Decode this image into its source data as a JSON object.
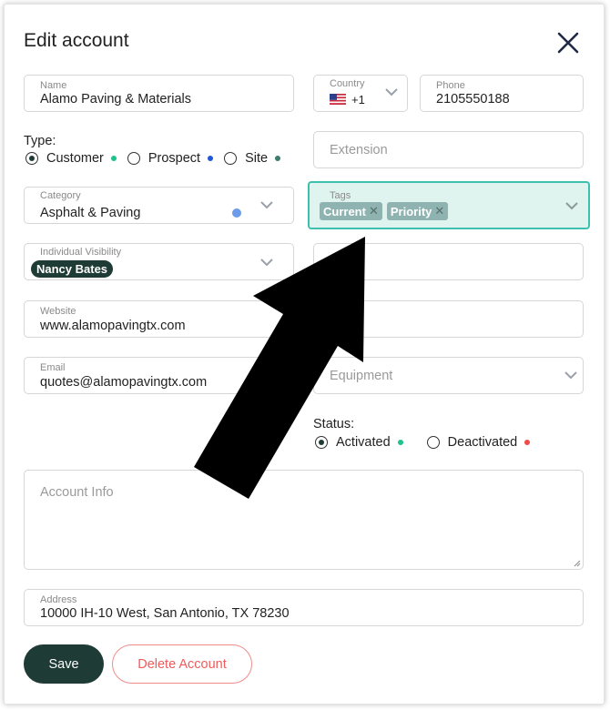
{
  "dialog": {
    "title": "Edit account"
  },
  "name": {
    "label": "Name",
    "value": "Alamo Paving & Materials"
  },
  "country": {
    "label": "Country",
    "code": "+1",
    "flag": "us-flag-icon"
  },
  "phone": {
    "label": "Phone",
    "value": "2105550188"
  },
  "type": {
    "label": "Type:",
    "options": [
      {
        "label": "Customer",
        "dot_color": "#1ec28b",
        "selected": true
      },
      {
        "label": "Prospect",
        "dot_color": "#1f57d6",
        "selected": false
      },
      {
        "label": "Site",
        "dot_color": "#3c7d6e",
        "selected": false
      }
    ]
  },
  "extension": {
    "placeholder": "Extension"
  },
  "category": {
    "label": "Category",
    "value": "Asphalt & Paving",
    "dot_color": "#6e9be8"
  },
  "tags": {
    "label": "Tags",
    "items": [
      "Current",
      "Priority"
    ],
    "accent": "#3fbfae"
  },
  "individual_visibility": {
    "label": "Individual Visibility",
    "chip": "Nancy Bates"
  },
  "website": {
    "label": "Website",
    "value": "www.alamopavingtx.com"
  },
  "email": {
    "label": "Email",
    "value": "quotes@alamopavingtx.com"
  },
  "equipment": {
    "placeholder": "Equipment"
  },
  "status": {
    "label": "Status:",
    "options": [
      {
        "label": "Activated",
        "dot_color": "#1ec28b",
        "selected": true
      },
      {
        "label": "Deactivated",
        "dot_color": "#ef4b4b",
        "selected": false
      }
    ]
  },
  "account_info": {
    "placeholder": "Account Info"
  },
  "address": {
    "label": "Address",
    "value": "10000 IH-10 West, San Antonio, TX 78230"
  },
  "buttons": {
    "save": "Save",
    "delete": "Delete Account"
  },
  "colors": {
    "primary": "#1f3b35",
    "danger": "#ef5b5b"
  }
}
